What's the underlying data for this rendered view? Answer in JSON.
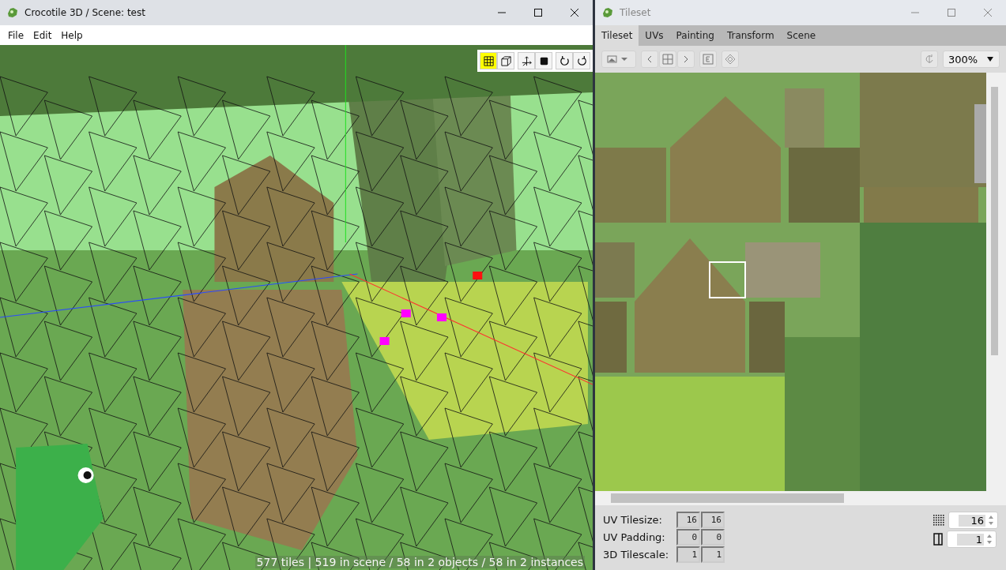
{
  "main_window": {
    "title": "Crocotile 3D / Scene: test",
    "menu": [
      "File",
      "Edit",
      "Help"
    ],
    "tool_groups": [
      [
        {
          "kind": "grid",
          "selected": true
        },
        {
          "kind": "cube",
          "selected": false
        }
      ],
      [
        {
          "kind": "axes",
          "selected": false
        },
        {
          "kind": "square",
          "selected": false
        }
      ],
      [
        {
          "kind": "rotate-left",
          "selected": false
        },
        {
          "kind": "rotate-right",
          "selected": false
        }
      ]
    ],
    "status": "577 tiles | 519 in scene / 58 in 2 objects / 58 in 2 instances"
  },
  "tileset_window": {
    "title": "Tileset",
    "tabs": [
      {
        "label": "Tileset",
        "selected": true
      },
      {
        "label": "UVs",
        "selected": false
      },
      {
        "label": "Painting",
        "selected": false
      },
      {
        "label": "Transform",
        "selected": false
      },
      {
        "label": "Scene",
        "selected": false
      }
    ],
    "zoom": "300%",
    "fields": [
      {
        "label": "UV Tilesize:",
        "values": [
          "16",
          "16"
        ]
      },
      {
        "label": "UV Padding:",
        "values": [
          "0",
          "0"
        ]
      },
      {
        "label": "3D Tilescale:",
        "values": [
          "1",
          "1"
        ]
      }
    ],
    "spinners": [
      {
        "kind": "grid",
        "value": "16"
      },
      {
        "kind": "border",
        "value": "1"
      }
    ]
  }
}
